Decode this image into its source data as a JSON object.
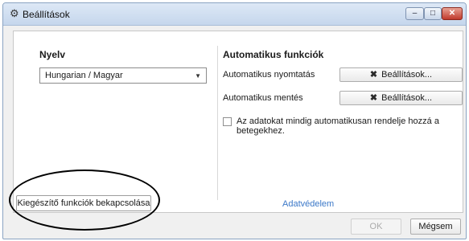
{
  "window": {
    "title": "Beállítások",
    "title_icon": "gear-icon",
    "controls": {
      "minimize": "–",
      "maximize": "□",
      "close": "✕"
    }
  },
  "language": {
    "heading": "Nyelv",
    "selected": "Hungarian / Magyar"
  },
  "auto": {
    "heading": "Automatikus funkciók",
    "rows": [
      {
        "label": "Automatikus nyomtatás",
        "button": "Beállítások..."
      },
      {
        "label": "Automatikus mentés",
        "button": "Beállítások..."
      }
    ],
    "checkbox_label": "Az adatokat mindig automatikusan rendelje hozzá a betegekhez.",
    "checkbox_checked": false
  },
  "privacy_link": "Adatvédelem",
  "addons_button": "Kiegészítő funkciók bekapcsolása",
  "footer": {
    "ok": "OK",
    "cancel": "Mégsem"
  },
  "colors": {
    "link": "#3b78c8",
    "titlebar": "#c5d6ec",
    "annotation_ellipse": "#000000"
  }
}
